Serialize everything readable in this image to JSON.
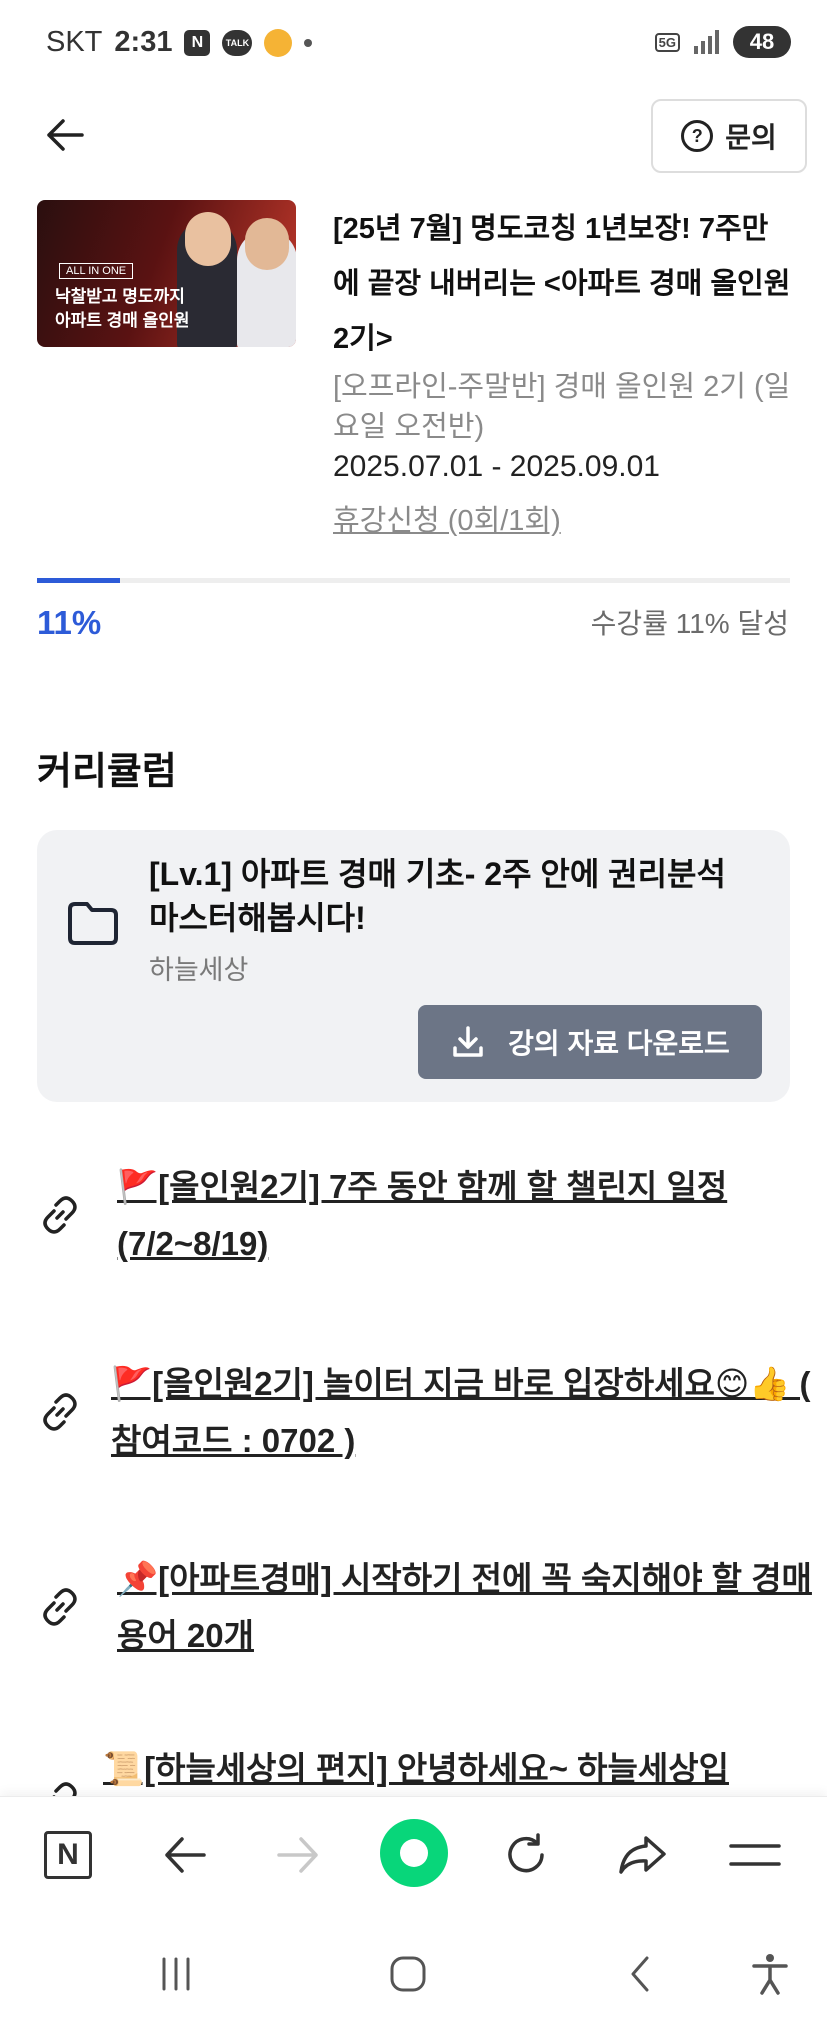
{
  "status_bar": {
    "carrier": "SKT",
    "time": "2:31",
    "network": "5G",
    "battery": "48"
  },
  "header": {
    "inquiry_label": "문의"
  },
  "course": {
    "thumbnail_badge": "ALL IN ONE",
    "thumbnail_line1": "낙찰받고 명도까지",
    "thumbnail_line2": "아파트 경매 올인원",
    "title": "[25년 7월] 명도코칭 1년보장! 7주만에 끝장 내버리는 <아파트 경매 올인원 2기>",
    "subtitle": "[오프라인-주말반] 경매 올인원 2기 (일요일 오전반)",
    "period": "2025.07.01 - 2025.09.01",
    "leave_link": "휴강신청 (0회/1회)"
  },
  "progress": {
    "percent": 11,
    "percent_label": "11%",
    "status_text": "수강률 11% 달성",
    "accent": "#2d5bd8"
  },
  "curriculum": {
    "title": "커리큘럼",
    "module": {
      "title": "[Lv.1] 아파트 경매 기초- 2주 안에 권리분석 마스터해봅시다!",
      "author": "하늘세상",
      "download_label": "강의 자료 다운로드"
    },
    "links": [
      {
        "text": "🚩[올인원2기] 7주 동안 함께 할 챌린지 일정 (7/2~8/19)"
      },
      {
        "text": "🚩[올인원2기] 놀이터 지금 바로 입장하세요😊👍 ( 참여코드 : 0702 )"
      },
      {
        "text": "📌[아파트경매] 시작하기 전에 꼭 숙지해야 할 경매 용어 20개"
      },
      {
        "text": "📜[하늘세상의 편지] 안녕하세요~ 하늘세상입"
      }
    ]
  },
  "browser_toolbar": {
    "home_label": "N"
  }
}
